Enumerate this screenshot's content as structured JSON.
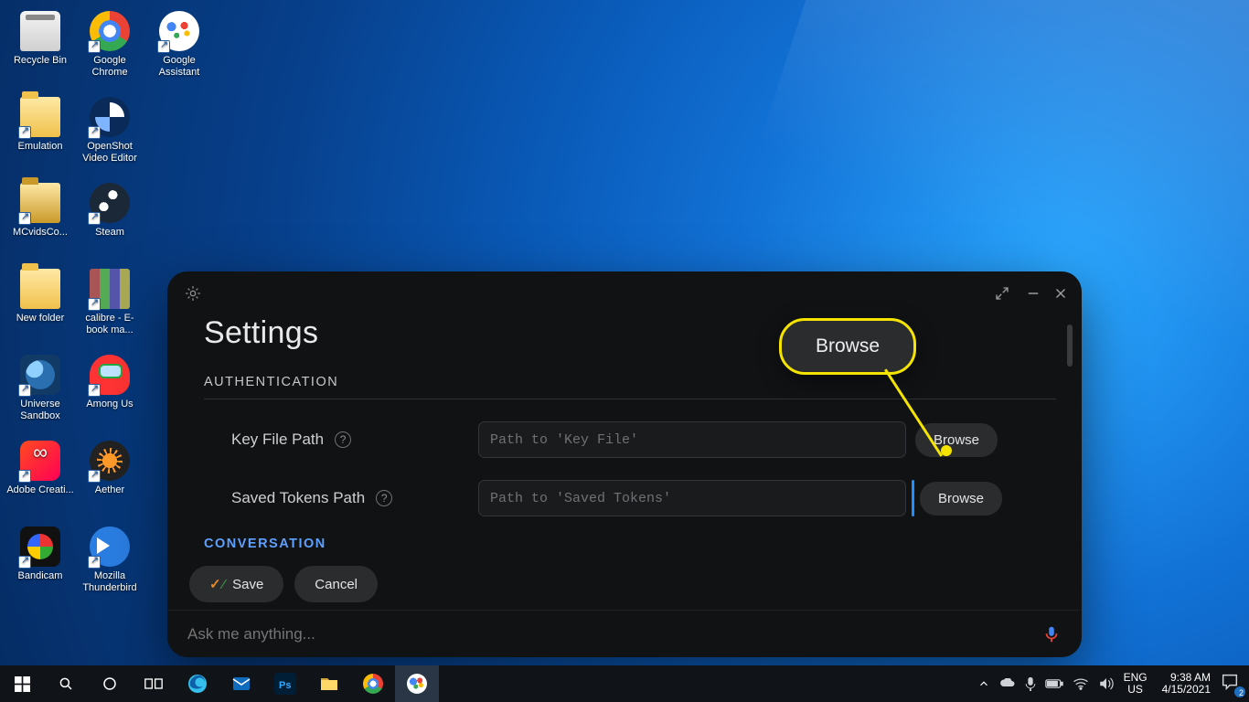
{
  "desktop_icons": {
    "col1": [
      "Recycle Bin",
      "Emulation",
      "MCvidsCo...",
      "New folder",
      "Universe Sandbox",
      "Adobe Creati...",
      "Bandicam"
    ],
    "col2": [
      "Google Chrome",
      "OpenShot Video Editor",
      "Steam",
      "calibre - E-book ma...",
      "Among Us",
      "Aether",
      "Mozilla Thunderbird"
    ],
    "col3": [
      "Google Assistant"
    ]
  },
  "callout": {
    "label": "Browse"
  },
  "window": {
    "title": "Settings",
    "section_auth": "AUTHENTICATION",
    "section_conv": "CONVERSATION",
    "key_label": "Key File Path",
    "key_placeholder": "Path to 'Key File'",
    "tokens_label": "Saved Tokens Path",
    "tokens_placeholder": "Path to 'Saved Tokens'",
    "browse": "Browse",
    "save": "Save",
    "cancel": "Cancel",
    "ask_placeholder": "Ask me anything..."
  },
  "tray": {
    "lang_top": "ENG",
    "lang_bottom": "US",
    "time": "9:38 AM",
    "date": "4/15/2021",
    "notif_count": "2"
  }
}
